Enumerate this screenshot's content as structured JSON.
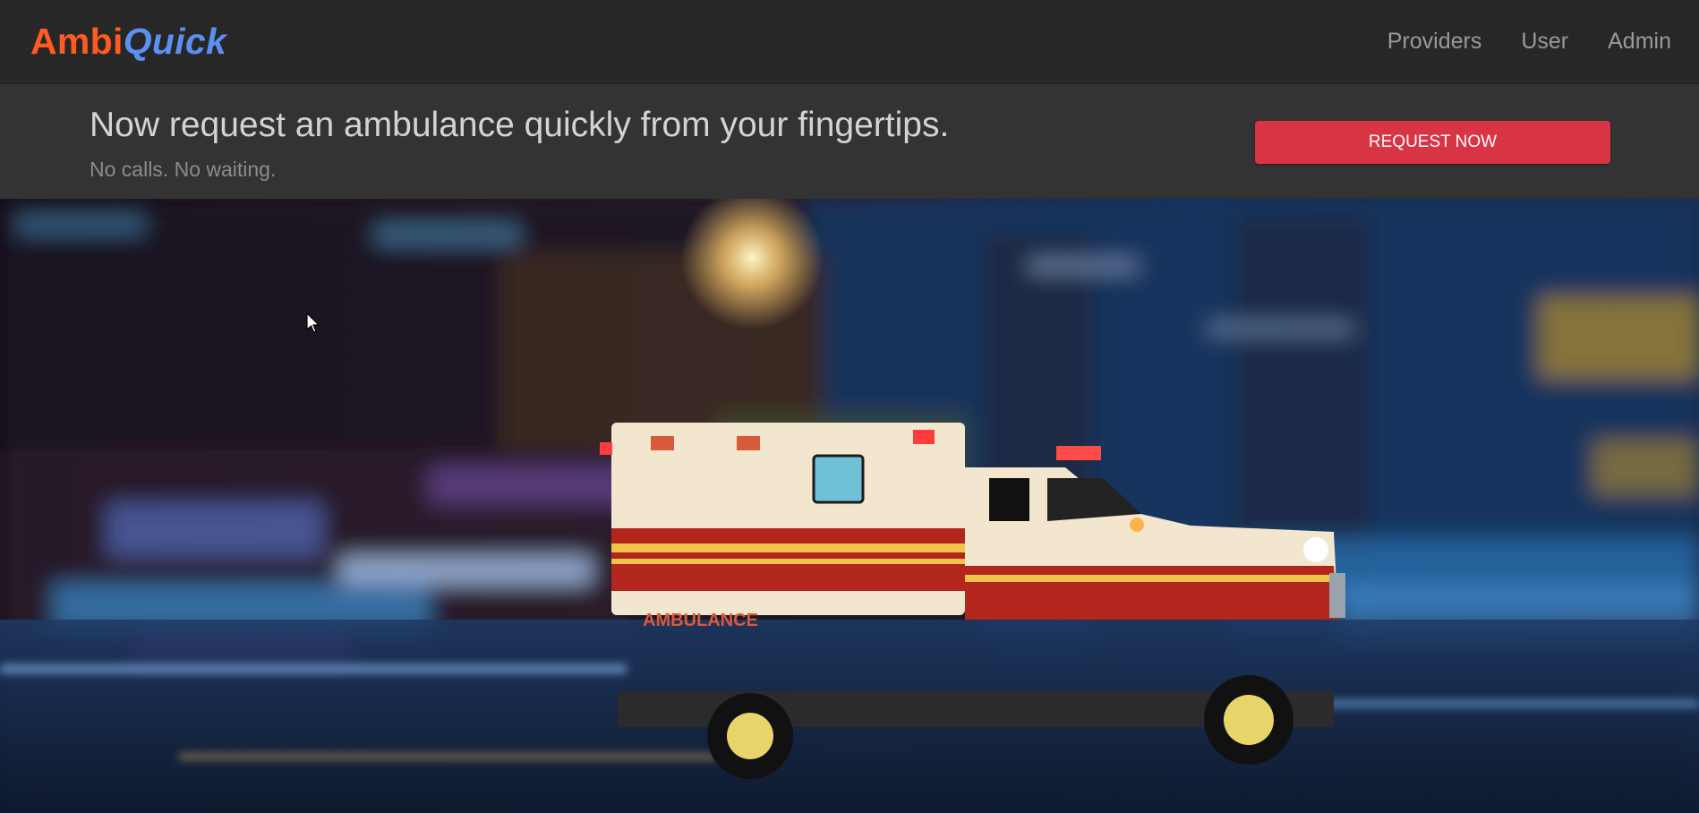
{
  "brand": {
    "part1": "Ambi",
    "part2": "Quick"
  },
  "nav": {
    "items": [
      "Providers",
      "User",
      "Admin"
    ]
  },
  "banner": {
    "headline": "Now request an ambulance quickly from your fingertips.",
    "subline": "No calls. No waiting.",
    "cta_label": "REQUEST NOW"
  },
  "hero": {
    "vehicle_text": "AMBULANCE"
  },
  "colors": {
    "brand_primary": "#ff5a1f",
    "brand_secondary": "#5b8ff0",
    "cta": "#d93444",
    "navbar_bg": "#272727",
    "banner_bg": "#333333"
  }
}
